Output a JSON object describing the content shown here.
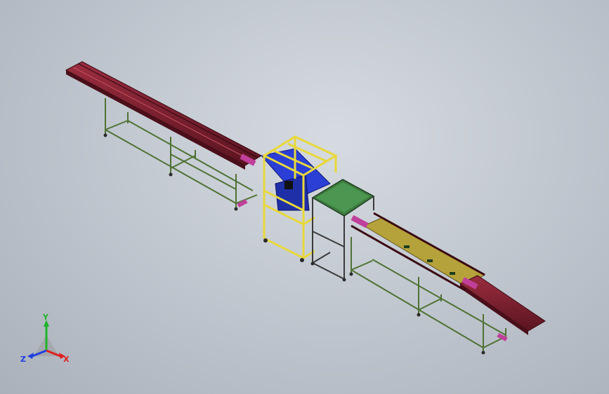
{
  "viewport": {
    "title": "",
    "background_top": "#d6dbe1",
    "background_bottom": "#aab1bb"
  },
  "model": {
    "kind": "conveyor-line-assembly",
    "colors": {
      "rail": "#7a1f2e",
      "rail_edge": "#3a0a12",
      "frame": "#5b7f3a",
      "station_frame": "#e8d83a",
      "carriage": "#2b3fd6",
      "tray": "#3d7c3f",
      "pad": "#c0409a",
      "accent": "#b6a23a"
    }
  },
  "triad": {
    "x_label": "X",
    "y_label": "Y",
    "z_label": "Z",
    "x_color": "#e02020",
    "y_color": "#1fb52a",
    "z_color": "#2040e0"
  }
}
